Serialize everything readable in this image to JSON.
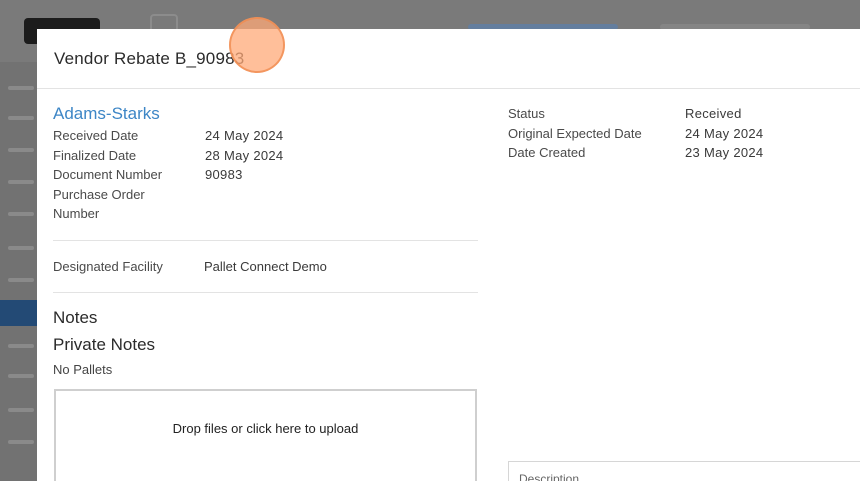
{
  "modal": {
    "title": "Vendor Rebate B_90983"
  },
  "details": {
    "vendor": "Adams-Starks",
    "fields": [
      {
        "label": "Received Date",
        "value": "24 May 2024"
      },
      {
        "label": "Finalized Date",
        "value": "28 May 2024"
      },
      {
        "label": "Document Number",
        "value": "90983"
      },
      {
        "label": "Purchase Order Number",
        "value": ""
      }
    ],
    "facility": {
      "label": "Designated Facility",
      "value": "Pallet Connect Demo"
    }
  },
  "status": {
    "fields": [
      {
        "label": "Status",
        "value": "Received"
      },
      {
        "label": "Original Expected Date",
        "value": "24 May 2024"
      },
      {
        "label": "Date Created",
        "value": "23 May 2024"
      }
    ]
  },
  "sections": {
    "notes": "Notes",
    "private_notes": "Private Notes",
    "pallets_text": "No Pallets"
  },
  "upload": {
    "text": "Drop files or click here to upload"
  },
  "description": {
    "label": "Description"
  }
}
